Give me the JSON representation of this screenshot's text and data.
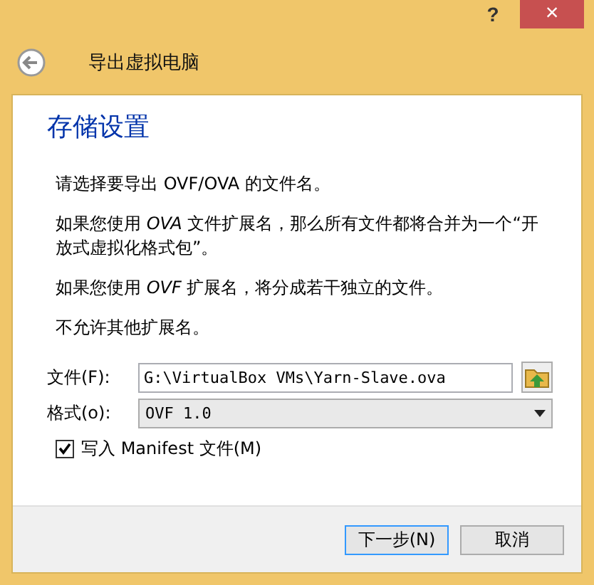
{
  "window": {
    "help": "?",
    "close": "×"
  },
  "header": {
    "title": "导出虚拟电脑"
  },
  "page": {
    "title": "存储设置",
    "paragraphs": [
      "请选择要导出 OVF/OVA 的文件名。",
      "如果您使用 *OVA* 文件扩展名，那么所有文件都将合并为一个“开放式虚拟化格式包”。",
      "如果您使用 *OVF* 扩展名，将分成若干独立的文件。",
      "不允许其他扩展名。"
    ],
    "file": {
      "label": "文件(F):",
      "value": "G:\\VirtualBox VMs\\Yarn-Slave.ova"
    },
    "format": {
      "label": "格式(o):",
      "value": "OVF 1.0"
    },
    "manifest": {
      "label": "写入 Manifest 文件(M)",
      "checked": true
    }
  },
  "buttons": [
    {
      "label": "下一步(N)",
      "selected": true
    },
    {
      "label": "取消",
      "selected": false
    }
  ]
}
